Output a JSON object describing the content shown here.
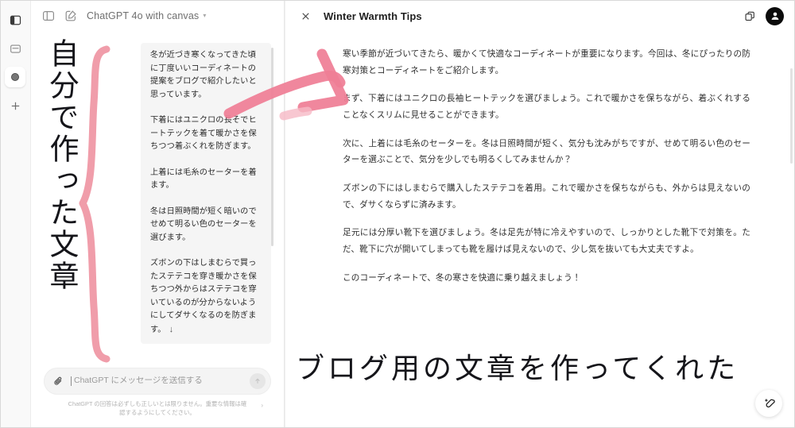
{
  "window": {
    "border_color": "#d9d9d9",
    "background": "#ffffff"
  },
  "rail": {
    "items": [
      {
        "name": "sidebar-panel-icon",
        "label": "サイドバー"
      },
      {
        "name": "archive-icon",
        "label": "アーカイブ"
      },
      {
        "name": "gpts-icon",
        "label": "GPT"
      },
      {
        "name": "plus-icon",
        "label": "新規"
      }
    ]
  },
  "chat": {
    "header": {
      "sidebar_toggle": "sidebar-toggle-icon",
      "new_chat": "new-chat-icon",
      "model": "ChatGPT 4o with canvas",
      "caret": "▾"
    },
    "messages": [
      "冬が近づき寒くなってきた頃に丁度いいコーディネートの提案をブログで紹介したいと思っています。",
      "下着にはユニクロの長そでヒートテックを着て暖かさを保ちつつ着ぶくれを防ぎます。",
      "上着には毛糸のセーターを着ます。",
      "冬は日照時間が短く暗いのでせめて明るい色のセーターを選びます。",
      "ズボンの下はしまむらで買ったステテコを穿き暖かさを保ちつつ外からはステテコを穿いているのが分からないようにしてダサくなるのを防ぎます。"
    ],
    "message_trailing_glyph": "↓",
    "composer": {
      "attach_icon": "paperclip-icon",
      "placeholder": "ChatGPT にメッセージを送信する",
      "send_icon": "send-arrow-icon"
    },
    "disclaimer": "ChatGPT の回答は必ずしも正しいとは限りません。重要な情報は確認するようにしてください。",
    "disclaimer_caret": "›"
  },
  "canvas": {
    "close_icon": "close-icon",
    "title": "Winter Warmth Tips",
    "copy_icon": "copy-icon",
    "avatar_icon": "user-avatar-icon",
    "paragraphs": [
      "寒い季節が近づいてきたら、暖かくて快適なコーディネートが重要になります。今回は、冬にぴったりの防寒対策とコーディネートをご紹介します。",
      "まず、下着にはユニクロの長袖ヒートテックを選びましょう。これで暖かさを保ちながら、着ぶくれすることなくスリムに見せることができます。",
      "次に、上着には毛糸のセーターを。冬は日照時間が短く、気分も沈みがちですが、せめて明るい色のセーターを選ぶことで、気分を少しでも明るくしてみませんか？",
      "ズボンの下にはしまむらで購入したステテコを着用。これで暖かさを保ちながらも、外からは見えないので、ダサくならずに済みます。",
      "足元には分厚い靴下を選びましょう。冬は足先が特に冷えやすいので、しっかりとした靴下で対策を。ただ、靴下に穴が開いてしまっても靴を履けば見えないので、少し気を抜いても大丈夫ですよ。",
      "このコーディネートで、冬の寒さを快適に乗り越えましょう！"
    ],
    "fab_icon": "magic-pencil-icon"
  },
  "annotations": {
    "vertical_text": "自分で作った文章",
    "bottom_text": "ブログ用の文章を作ってくれた",
    "marker_color": "#ee8a9b",
    "brace_color": "#ef95a3",
    "arrow_color": "#ef7e96"
  }
}
